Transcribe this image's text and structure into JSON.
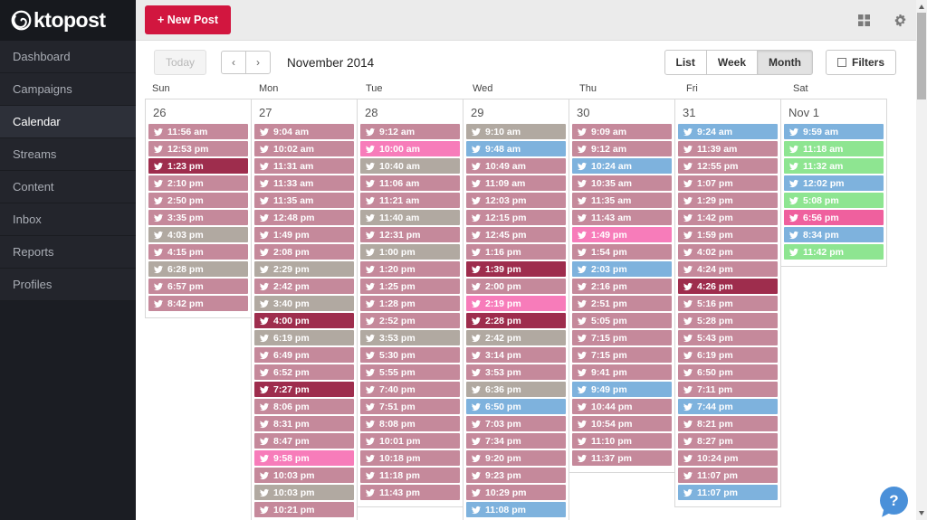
{
  "brand": {
    "logo_text": "ktopost"
  },
  "sidebar": {
    "items": [
      {
        "label": "Dashboard",
        "active": false
      },
      {
        "label": "Campaigns",
        "active": false
      },
      {
        "label": "Calendar",
        "active": true
      },
      {
        "label": "Streams",
        "active": false
      },
      {
        "label": "Content",
        "active": false
      },
      {
        "label": "Inbox",
        "active": false
      },
      {
        "label": "Reports",
        "active": false
      },
      {
        "label": "Profiles",
        "active": false
      }
    ]
  },
  "topbar": {
    "new_post_label": "+ New Post",
    "icons": [
      "apps-grid-icon",
      "gear-icon"
    ]
  },
  "toolbar": {
    "today_label": "Today",
    "prev_label": "‹",
    "next_label": "›",
    "month_title": "November 2014",
    "view_options": [
      "List",
      "Week",
      "Month"
    ],
    "active_view": "Month",
    "filters_label": "Filters"
  },
  "help": {
    "label": "?"
  },
  "colors": {
    "accent_red": "#d2163f",
    "entry_mauve": "#c5899b",
    "entry_maroon": "#9e2d4d",
    "entry_gray": "#b1a9a1",
    "entry_pink": "#f77cba",
    "entry_blue": "#7eb2dd",
    "entry_green": "#8ee591",
    "entry_magenta": "#ef609e"
  },
  "calendar": {
    "day_headers": [
      "Sun",
      "Mon",
      "Tue",
      "Wed",
      "Thu",
      "Fri",
      "Sat"
    ],
    "columns": [
      {
        "date": "26",
        "entries": [
          {
            "network": "twitter",
            "time": "11:56 am",
            "color": "mauve"
          },
          {
            "network": "twitter",
            "time": "12:53 pm",
            "color": "mauve"
          },
          {
            "network": "twitter",
            "time": "1:23 pm",
            "color": "maroon"
          },
          {
            "network": "twitter",
            "time": "2:10 pm",
            "color": "mauve"
          },
          {
            "network": "twitter",
            "time": "2:50 pm",
            "color": "mauve"
          },
          {
            "network": "twitter",
            "time": "3:35 pm",
            "color": "mauve"
          },
          {
            "network": "twitter",
            "time": "4:03 pm",
            "color": "gray"
          },
          {
            "network": "twitter",
            "time": "4:15 pm",
            "color": "mauve"
          },
          {
            "network": "twitter",
            "time": "6:28 pm",
            "color": "gray"
          },
          {
            "network": "twitter",
            "time": "6:57 pm",
            "color": "mauve"
          },
          {
            "network": "twitter",
            "time": "8:42 pm",
            "color": "mauve"
          }
        ]
      },
      {
        "date": "27",
        "entries": [
          {
            "network": "twitter",
            "time": "9:04 am",
            "color": "mauve"
          },
          {
            "network": "twitter",
            "time": "10:02 am",
            "color": "mauve"
          },
          {
            "network": "twitter",
            "time": "11:31 am",
            "color": "mauve"
          },
          {
            "network": "twitter",
            "time": "11:33 am",
            "color": "mauve"
          },
          {
            "network": "twitter",
            "time": "11:35 am",
            "color": "mauve"
          },
          {
            "network": "twitter",
            "time": "12:48 pm",
            "color": "mauve"
          },
          {
            "network": "twitter",
            "time": "1:49 pm",
            "color": "mauve"
          },
          {
            "network": "twitter",
            "time": "2:08 pm",
            "color": "mauve"
          },
          {
            "network": "twitter",
            "time": "2:29 pm",
            "color": "gray"
          },
          {
            "network": "twitter",
            "time": "2:42 pm",
            "color": "mauve"
          },
          {
            "network": "twitter",
            "time": "3:40 pm",
            "color": "gray"
          },
          {
            "network": "twitter",
            "time": "4:00 pm",
            "color": "maroon"
          },
          {
            "network": "twitter",
            "time": "6:19 pm",
            "color": "gray"
          },
          {
            "network": "twitter",
            "time": "6:49 pm",
            "color": "mauve"
          },
          {
            "network": "twitter",
            "time": "6:52 pm",
            "color": "mauve"
          },
          {
            "network": "twitter",
            "time": "7:27 pm",
            "color": "maroon"
          },
          {
            "network": "twitter",
            "time": "8:06 pm",
            "color": "mauve"
          },
          {
            "network": "twitter",
            "time": "8:31 pm",
            "color": "mauve"
          },
          {
            "network": "twitter",
            "time": "8:47 pm",
            "color": "mauve"
          },
          {
            "network": "twitter",
            "time": "9:58 pm",
            "color": "pink"
          },
          {
            "network": "twitter",
            "time": "10:03 pm",
            "color": "mauve"
          },
          {
            "network": "twitter",
            "time": "10:03 pm",
            "color": "gray"
          },
          {
            "network": "twitter",
            "time": "10:21 pm",
            "color": "mauve"
          }
        ]
      },
      {
        "date": "28",
        "entries": [
          {
            "network": "twitter",
            "time": "9:12 am",
            "color": "mauve"
          },
          {
            "network": "twitter",
            "time": "10:00 am",
            "color": "pink"
          },
          {
            "network": "twitter",
            "time": "10:40 am",
            "color": "gray"
          },
          {
            "network": "twitter",
            "time": "11:06 am",
            "color": "mauve"
          },
          {
            "network": "twitter",
            "time": "11:21 am",
            "color": "mauve"
          },
          {
            "network": "twitter",
            "time": "11:40 am",
            "color": "gray"
          },
          {
            "network": "twitter",
            "time": "12:31 pm",
            "color": "mauve"
          },
          {
            "network": "twitter",
            "time": "1:00 pm",
            "color": "gray"
          },
          {
            "network": "twitter",
            "time": "1:20 pm",
            "color": "mauve"
          },
          {
            "network": "twitter",
            "time": "1:25 pm",
            "color": "mauve"
          },
          {
            "network": "twitter",
            "time": "1:28 pm",
            "color": "mauve"
          },
          {
            "network": "twitter",
            "time": "2:52 pm",
            "color": "mauve"
          },
          {
            "network": "twitter",
            "time": "3:53 pm",
            "color": "gray"
          },
          {
            "network": "twitter",
            "time": "5:30 pm",
            "color": "mauve"
          },
          {
            "network": "twitter",
            "time": "5:55 pm",
            "color": "mauve"
          },
          {
            "network": "twitter",
            "time": "7:40 pm",
            "color": "mauve"
          },
          {
            "network": "twitter",
            "time": "7:51 pm",
            "color": "mauve"
          },
          {
            "network": "twitter",
            "time": "8:08 pm",
            "color": "mauve"
          },
          {
            "network": "twitter",
            "time": "10:01 pm",
            "color": "mauve"
          },
          {
            "network": "twitter",
            "time": "10:18 pm",
            "color": "mauve"
          },
          {
            "network": "twitter",
            "time": "11:18 pm",
            "color": "mauve"
          },
          {
            "network": "twitter",
            "time": "11:43 pm",
            "color": "mauve"
          }
        ]
      },
      {
        "date": "29",
        "entries": [
          {
            "network": "twitter",
            "time": "9:10 am",
            "color": "gray"
          },
          {
            "network": "twitter",
            "time": "9:48 am",
            "color": "blue"
          },
          {
            "network": "twitter",
            "time": "10:49 am",
            "color": "mauve"
          },
          {
            "network": "twitter",
            "time": "11:09 am",
            "color": "mauve"
          },
          {
            "network": "twitter",
            "time": "12:03 pm",
            "color": "mauve"
          },
          {
            "network": "twitter",
            "time": "12:15 pm",
            "color": "mauve"
          },
          {
            "network": "twitter",
            "time": "12:45 pm",
            "color": "mauve"
          },
          {
            "network": "twitter",
            "time": "1:16 pm",
            "color": "mauve"
          },
          {
            "network": "twitter",
            "time": "1:39 pm",
            "color": "maroon"
          },
          {
            "network": "twitter",
            "time": "2:00 pm",
            "color": "mauve"
          },
          {
            "network": "twitter",
            "time": "2:19 pm",
            "color": "pink"
          },
          {
            "network": "twitter",
            "time": "2:28 pm",
            "color": "maroon"
          },
          {
            "network": "twitter",
            "time": "2:42 pm",
            "color": "gray"
          },
          {
            "network": "twitter",
            "time": "3:14 pm",
            "color": "mauve"
          },
          {
            "network": "twitter",
            "time": "3:53 pm",
            "color": "mauve"
          },
          {
            "network": "twitter",
            "time": "6:36 pm",
            "color": "gray"
          },
          {
            "network": "twitter",
            "time": "6:50 pm",
            "color": "blue"
          },
          {
            "network": "twitter",
            "time": "7:03 pm",
            "color": "mauve"
          },
          {
            "network": "twitter",
            "time": "7:34 pm",
            "color": "mauve"
          },
          {
            "network": "twitter",
            "time": "9:20 pm",
            "color": "mauve"
          },
          {
            "network": "twitter",
            "time": "9:23 pm",
            "color": "mauve"
          },
          {
            "network": "twitter",
            "time": "10:29 pm",
            "color": "mauve"
          },
          {
            "network": "twitter",
            "time": "11:08 pm",
            "color": "blue"
          }
        ]
      },
      {
        "date": "30",
        "entries": [
          {
            "network": "twitter",
            "time": "9:09 am",
            "color": "mauve"
          },
          {
            "network": "twitter",
            "time": "9:12 am",
            "color": "mauve"
          },
          {
            "network": "twitter",
            "time": "10:24 am",
            "color": "blue"
          },
          {
            "network": "twitter",
            "time": "10:35 am",
            "color": "mauve"
          },
          {
            "network": "twitter",
            "time": "11:35 am",
            "color": "mauve"
          },
          {
            "network": "twitter",
            "time": "11:43 am",
            "color": "mauve"
          },
          {
            "network": "twitter",
            "time": "1:49 pm",
            "color": "pink"
          },
          {
            "network": "twitter",
            "time": "1:54 pm",
            "color": "mauve"
          },
          {
            "network": "twitter",
            "time": "2:03 pm",
            "color": "blue"
          },
          {
            "network": "twitter",
            "time": "2:16 pm",
            "color": "mauve"
          },
          {
            "network": "twitter",
            "time": "2:51 pm",
            "color": "mauve"
          },
          {
            "network": "twitter",
            "time": "5:05 pm",
            "color": "mauve"
          },
          {
            "network": "twitter",
            "time": "7:15 pm",
            "color": "mauve"
          },
          {
            "network": "twitter",
            "time": "7:15 pm",
            "color": "mauve"
          },
          {
            "network": "twitter",
            "time": "9:41 pm",
            "color": "mauve"
          },
          {
            "network": "twitter",
            "time": "9:49 pm",
            "color": "blue"
          },
          {
            "network": "twitter",
            "time": "10:44 pm",
            "color": "mauve"
          },
          {
            "network": "twitter",
            "time": "10:54 pm",
            "color": "mauve"
          },
          {
            "network": "twitter",
            "time": "11:10 pm",
            "color": "mauve"
          },
          {
            "network": "twitter",
            "time": "11:37 pm",
            "color": "mauve"
          }
        ]
      },
      {
        "date": "31",
        "entries": [
          {
            "network": "twitter",
            "time": "9:24 am",
            "color": "blue"
          },
          {
            "network": "twitter",
            "time": "11:39 am",
            "color": "mauve"
          },
          {
            "network": "twitter",
            "time": "12:55 pm",
            "color": "mauve"
          },
          {
            "network": "twitter",
            "time": "1:07 pm",
            "color": "mauve"
          },
          {
            "network": "twitter",
            "time": "1:29 pm",
            "color": "mauve"
          },
          {
            "network": "twitter",
            "time": "1:42 pm",
            "color": "mauve"
          },
          {
            "network": "twitter",
            "time": "1:59 pm",
            "color": "mauve"
          },
          {
            "network": "twitter",
            "time": "4:02 pm",
            "color": "mauve"
          },
          {
            "network": "twitter",
            "time": "4:24 pm",
            "color": "mauve"
          },
          {
            "network": "twitter",
            "time": "4:26 pm",
            "color": "maroon"
          },
          {
            "network": "twitter",
            "time": "5:16 pm",
            "color": "mauve"
          },
          {
            "network": "twitter",
            "time": "5:28 pm",
            "color": "mauve"
          },
          {
            "network": "twitter",
            "time": "5:43 pm",
            "color": "mauve"
          },
          {
            "network": "twitter",
            "time": "6:19 pm",
            "color": "mauve"
          },
          {
            "network": "twitter",
            "time": "6:50 pm",
            "color": "mauve"
          },
          {
            "network": "twitter",
            "time": "7:11 pm",
            "color": "mauve"
          },
          {
            "network": "twitter",
            "time": "7:44 pm",
            "color": "blue"
          },
          {
            "network": "twitter",
            "time": "8:21 pm",
            "color": "mauve"
          },
          {
            "network": "twitter",
            "time": "8:27 pm",
            "color": "mauve"
          },
          {
            "network": "twitter",
            "time": "10:24 pm",
            "color": "mauve"
          },
          {
            "network": "twitter",
            "time": "11:07 pm",
            "color": "mauve"
          },
          {
            "network": "twitter",
            "time": "11:07 pm",
            "color": "blue"
          }
        ]
      },
      {
        "date": "Nov 1",
        "entries": [
          {
            "network": "twitter",
            "time": "9:59 am",
            "color": "blue"
          },
          {
            "network": "twitter",
            "time": "11:18 am",
            "color": "green"
          },
          {
            "network": "twitter",
            "time": "11:32 am",
            "color": "green"
          },
          {
            "network": "twitter",
            "time": "12:02 pm",
            "color": "blue"
          },
          {
            "network": "twitter",
            "time": "5:08 pm",
            "color": "green"
          },
          {
            "network": "twitter",
            "time": "6:56 pm",
            "color": "magenta"
          },
          {
            "network": "twitter",
            "time": "8:34 pm",
            "color": "blue"
          },
          {
            "network": "twitter",
            "time": "11:42 pm",
            "color": "green"
          }
        ]
      }
    ]
  }
}
